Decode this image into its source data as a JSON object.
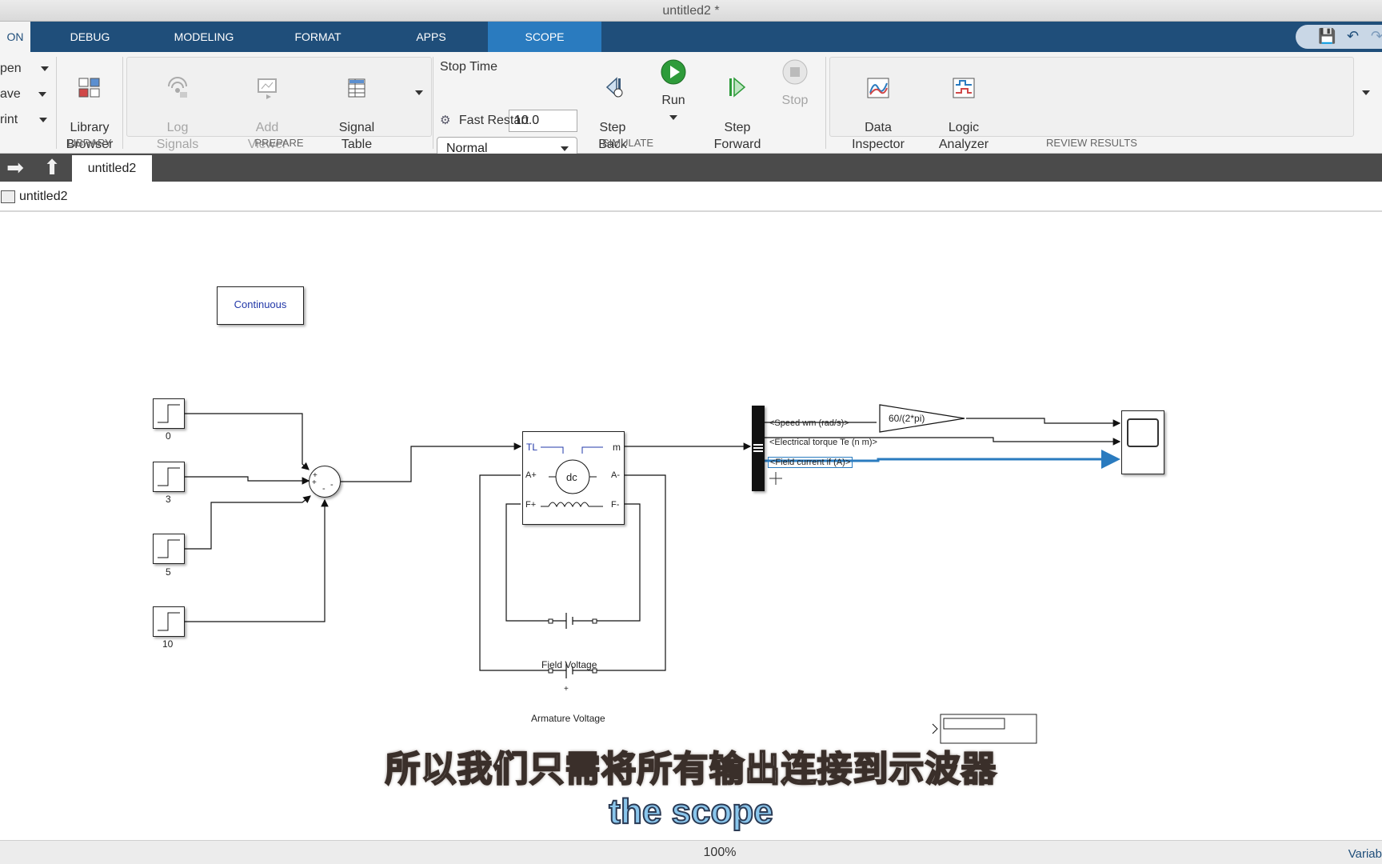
{
  "window": {
    "title": "untitled2 *"
  },
  "tabs": [
    {
      "label": "ON"
    },
    {
      "label": "DEBUG"
    },
    {
      "label": "MODELING"
    },
    {
      "label": "FORMAT"
    },
    {
      "label": "APPS"
    },
    {
      "label": "SCOPE"
    }
  ],
  "file_menu": {
    "open": "pen",
    "save": "ave",
    "print": "rint"
  },
  "library": {
    "library_browser": "Library\nBrowser",
    "group_label": "LIBRARY"
  },
  "prepare": {
    "log_signals": "Log\nSignals",
    "add_viewer": "Add\nViewer",
    "signal_table": "Signal\nTable",
    "group_label": "PREPARE"
  },
  "simulate": {
    "stop_time_label": "Stop Time",
    "stop_time_value": "10.0",
    "mode": "Normal",
    "fast_restart": "Fast Restart",
    "step_back": "Step\nBack",
    "run": "Run",
    "step_forward": "Step\nForward",
    "stop": "Stop",
    "group_label": "SIMULATE"
  },
  "review": {
    "data_inspector": "Data\nInspector",
    "logic_analyzer": "Logic\nAnalyzer",
    "group_label": "REVIEW RESULTS"
  },
  "nav": {
    "doc_tab": "untitled2",
    "path": "untitled2"
  },
  "diagram": {
    "powergui": "Continuous",
    "steps": [
      "0",
      "3",
      "5",
      "10"
    ],
    "sum_signs": [
      "+",
      "+",
      "-",
      "-"
    ],
    "motor": {
      "tl": "TL",
      "m": "m",
      "a_plus": "A+",
      "a_minus": "A-",
      "f_plus": "F+",
      "f_minus": "F-",
      "dc": "dc"
    },
    "field_voltage": "Field Voltage",
    "armature_voltage": "Armature Voltage",
    "bus_signals": [
      "<Speed wm (rad/s)>",
      "<Electrical torque Te (n m)>",
      "<Field current if (A)>"
    ],
    "gain": "60/(2*pi)"
  },
  "subtitles": {
    "chinese": "所以我们只需将所有输出连接到示波器",
    "english": "the scope"
  },
  "status": {
    "zoom": "100%",
    "right": "Variab"
  },
  "colors": {
    "ribbon_tab_bg": "#1f4e7a",
    "active_tab": "#2a7bbf",
    "run_green": "#2e9b3a",
    "selected_signal": "#2a7bbf"
  }
}
